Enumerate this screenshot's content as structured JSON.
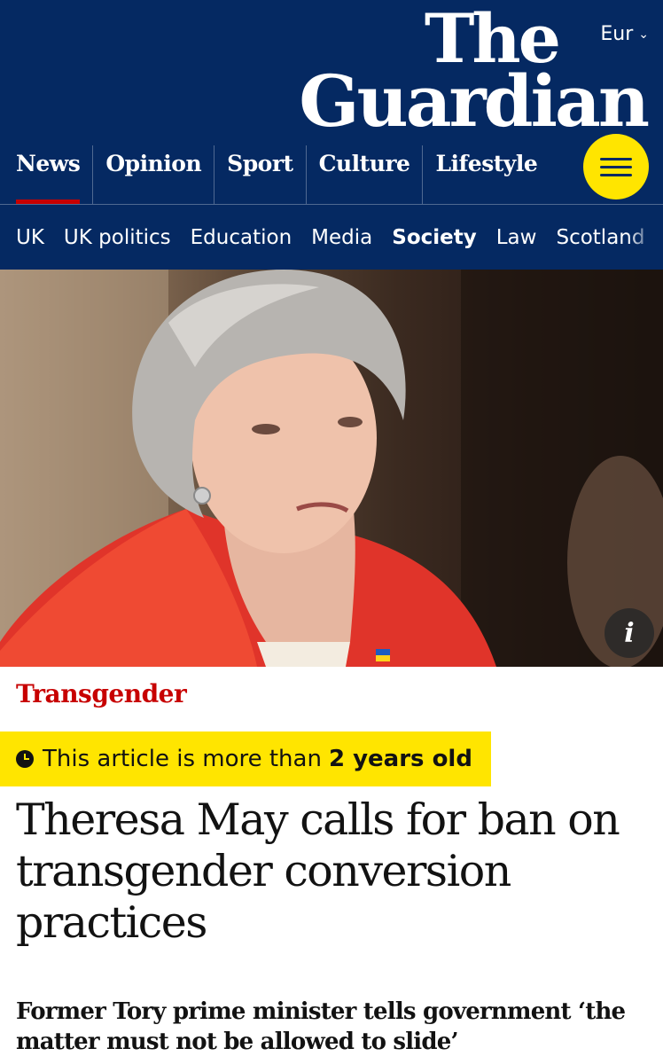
{
  "header": {
    "edition": "Eur",
    "logo_line1": "The",
    "logo_line2": "Guardian",
    "pillars": [
      {
        "label": "News",
        "active": true
      },
      {
        "label": "Opinion"
      },
      {
        "label": "Sport"
      },
      {
        "label": "Culture"
      },
      {
        "label": "Lifestyle"
      }
    ],
    "subnav": [
      "UK",
      "UK politics",
      "Education",
      "Media",
      "Society",
      "Law",
      "Scotland"
    ],
    "subnav_current": "Society",
    "colors": {
      "brand": "#052962",
      "menu_button": "#ffe500",
      "active_underline": "#c70000"
    }
  },
  "hero": {
    "info_icon": "i"
  },
  "article": {
    "kicker": "Transgender",
    "age_warning_prefix": "This article is more than",
    "age_warning_strong": "2 years old",
    "headline": "Theresa May calls for ban on transgender conversion practices",
    "standfirst": "Former Tory prime minister tells government ‘the matter must not be allowed to slide’",
    "colors": {
      "kicker": "#c70000",
      "age_warning_bg": "#ffe500"
    }
  }
}
